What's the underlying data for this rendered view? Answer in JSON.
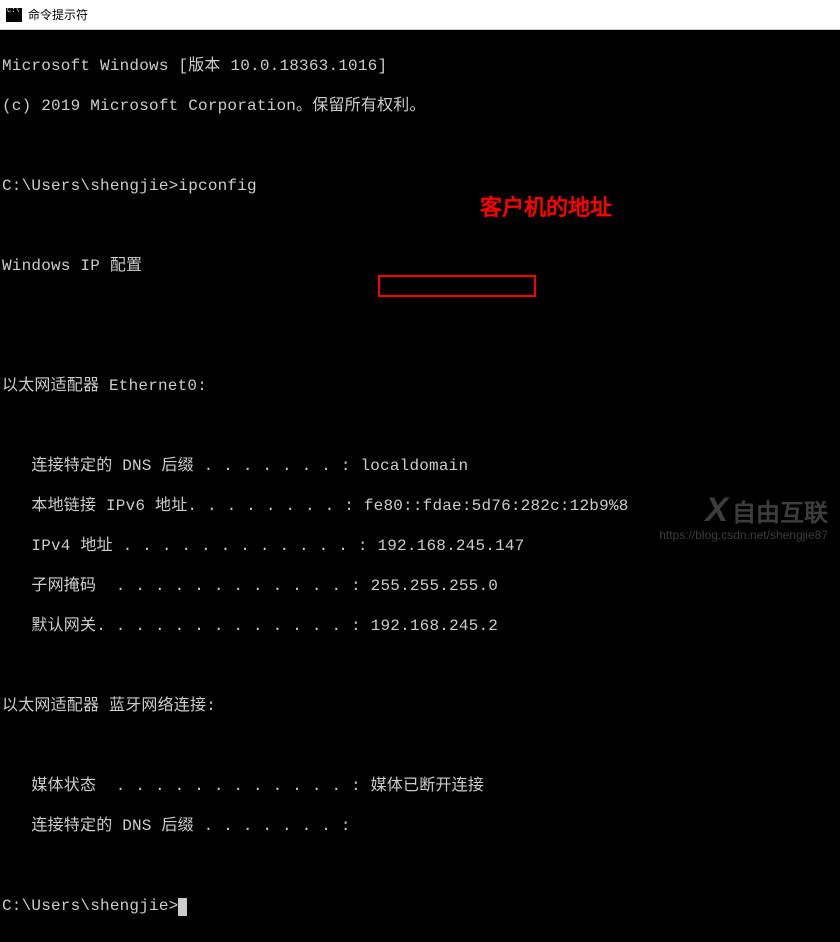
{
  "window": {
    "title": "命令提示符"
  },
  "terminal": {
    "version_line": "Microsoft Windows [版本 10.0.18363.1016]",
    "copyright": "(c) 2019 Microsoft Corporation。保留所有权利。",
    "prompt1": "C:\\Users\\shengjie>ipconfig",
    "ipconfig_header": "Windows IP 配置",
    "adapter1_header": "以太网适配器 Ethernet0:",
    "adapter1_dns_suffix_label": "   连接特定的 DNS 后缀 . . . . . . . :",
    "adapter1_dns_suffix_value": " localdomain",
    "adapter1_ipv6_label": "   本地链接 IPv6 地址. . . . . . . . :",
    "adapter1_ipv6_value": " fe80::fdae:5d76:282c:12b9%8",
    "adapter1_ipv4_label": "   IPv4 地址 . . . . . . . . . . . . :",
    "adapter1_ipv4_value": " 192.168.245.147",
    "adapter1_mask_label": "   子网掩码  . . . . . . . . . . . . :",
    "adapter1_mask_value": " 255.255.255.0",
    "adapter1_gateway_label": "   默认网关. . . . . . . . . . . . . :",
    "adapter1_gateway_value": " 192.168.245.2",
    "adapter2_header": "以太网适配器 蓝牙网络连接:",
    "adapter2_media_label": "   媒体状态  . . . . . . . . . . . . :",
    "adapter2_media_value": " 媒体已断开连接",
    "adapter2_dns_label": "   连接特定的 DNS 后缀 . . . . . . . :",
    "prompt2": "C:\\Users\\shengjie>"
  },
  "annotation": {
    "text": "客户机的地址"
  },
  "watermark": {
    "brand": "自由互联",
    "url": "https://blog.csdn.net/shengjie87"
  }
}
